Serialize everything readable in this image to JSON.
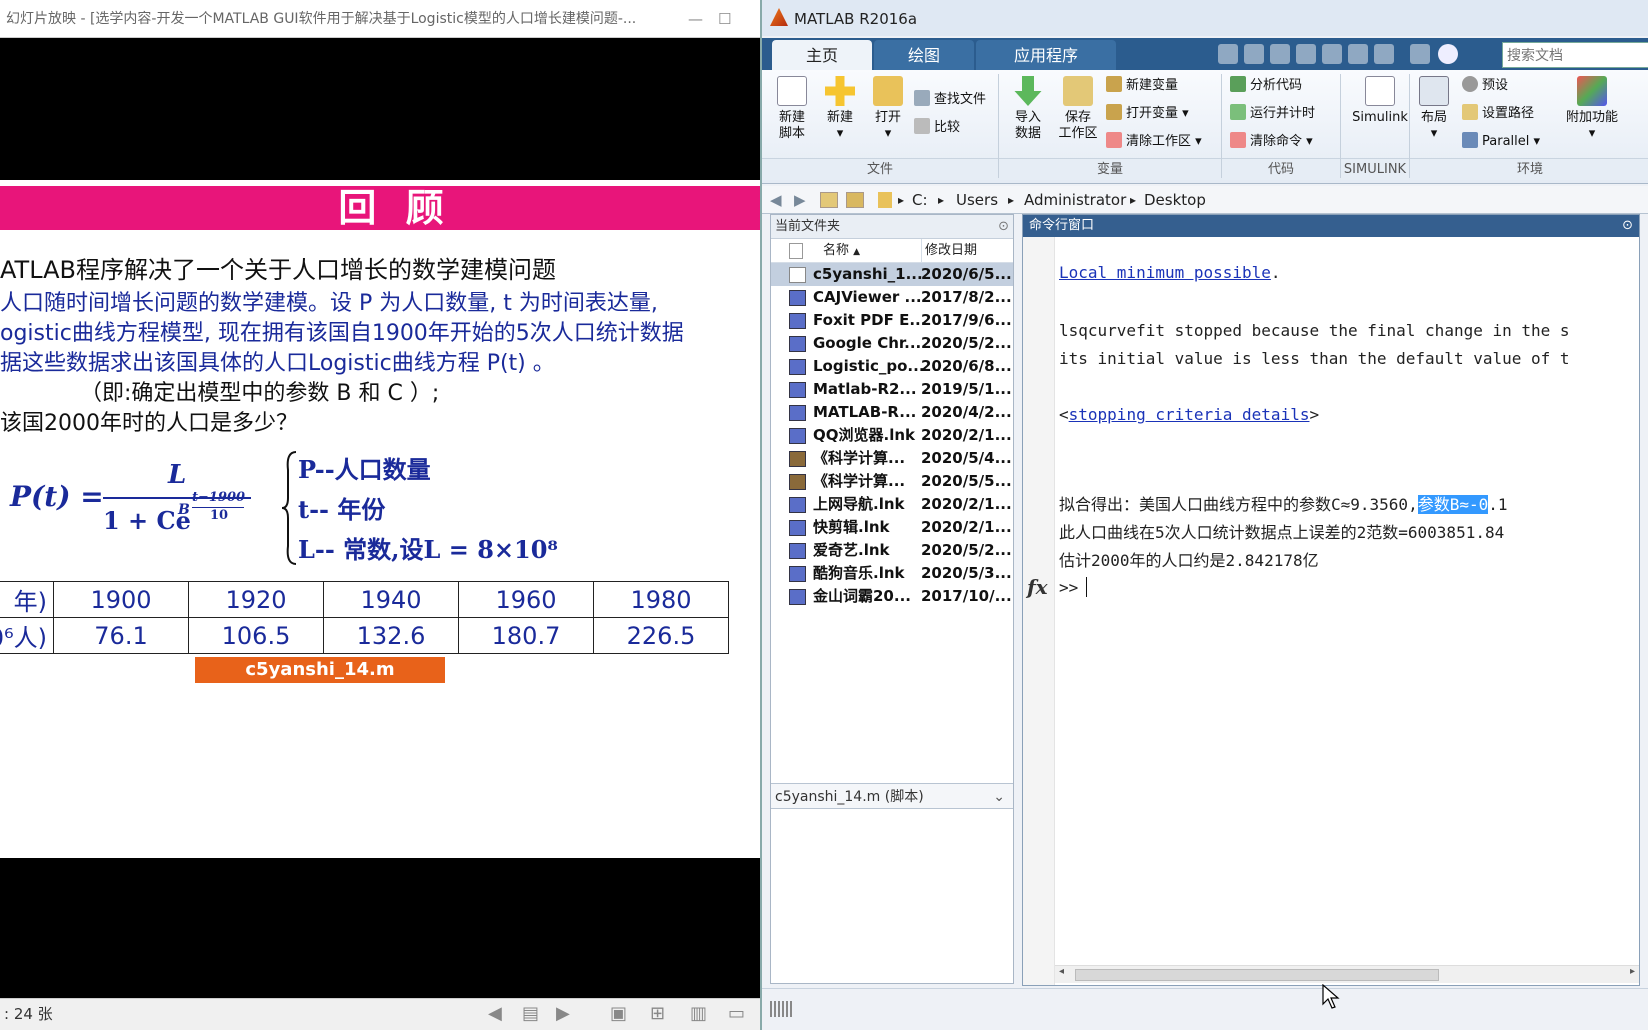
{
  "ppt": {
    "title": "幻灯片放映 - [选学内容-开发一个MATLAB GUI软件用于解决基于Logistic模型的人口增长建模问题-...",
    "minimize": "—",
    "maximize": "☐",
    "banner": "回 顾",
    "heading": "ATLAB程序解决了一个关于人口增长的数学建模问题",
    "lines": [
      "人口随时间增长问题的数学建模。设 P 为人口数量, t 为时间表达量,",
      "ogistic曲线方程模型, 现在拥有该国自1900年开始的5次人口统计数据",
      "据这些数据求出该国具体的人口Logistic曲线方程 P(t) 。",
      "（即:确定出模型中的参数 B 和 C ）;",
      "该国2000年时的人口是多少？"
    ],
    "formula": {
      "lhs": "P(t) =",
      "numerator": "L",
      "denominator": "1 + Ce",
      "base": "B",
      "exp_num": "t−1900",
      "exp_den": "10",
      "defs": [
        "P--人口数量",
        "t-- 年份",
        "L-- 常数,设L = 8×10⁸"
      ]
    },
    "table": {
      "row1_label": "年)",
      "row2_label": "0⁶人)",
      "years": [
        "1900",
        "1920",
        "1940",
        "1960",
        "1980"
      ],
      "pop": [
        "76.1",
        "106.5",
        "132.6",
        "180.7",
        "226.5"
      ]
    },
    "file_tag": "c5yanshi_14.m",
    "status": ": 24 张"
  },
  "matlab": {
    "title": "MATLAB R2016a",
    "tabs": [
      "主页",
      "绘图",
      "应用程序"
    ],
    "search_placeholder": "搜索文档",
    "ribbon": {
      "new_script": "新建\n脚本",
      "new": "新建",
      "open": "打开",
      "find_files": "查找文件",
      "compare": "比较",
      "import": "导入\n数据",
      "save_ws": "保存\n工作区",
      "new_var": "新建变量",
      "open_var": "打开变量",
      "clear_ws": "清除工作区",
      "analyze": "分析代码",
      "run_time": "运行并计时",
      "clear_cmd": "清除命令",
      "simulink": "Simulink",
      "layout": "布局",
      "prefs": "预设",
      "set_path": "设置路径",
      "parallel": "Parallel",
      "addons": "附加功能",
      "groups": [
        "文件",
        "变量",
        "代码",
        "SIMULINK",
        "环境"
      ]
    },
    "path": [
      "C:",
      "Users",
      "Administrator",
      "Desktop"
    ],
    "folder_panel": {
      "title": "当前文件夹",
      "col_name": "名称",
      "col_date": "修改日期",
      "files": [
        {
          "name": "c5yanshi_1...",
          "date": "2020/6/5..."
        },
        {
          "name": "CAJViewer ...",
          "date": "2017/8/2..."
        },
        {
          "name": "Foxit PDF E...",
          "date": "2017/9/6..."
        },
        {
          "name": "Google Chr...",
          "date": "2020/5/2..."
        },
        {
          "name": "Logistic_po...",
          "date": "2020/6/8..."
        },
        {
          "name": "Matlab-R2...",
          "date": "2019/5/1..."
        },
        {
          "name": "MATLAB-R...",
          "date": "2020/4/2..."
        },
        {
          "name": "QQ浏览器.lnk",
          "date": "2020/2/1..."
        },
        {
          "name": "《科学计算...",
          "date": "2020/5/4..."
        },
        {
          "name": "《科学计算...",
          "date": "2020/5/5..."
        },
        {
          "name": "上网导航.lnk",
          "date": "2020/2/1..."
        },
        {
          "name": "快剪辑.lnk",
          "date": "2020/2/1..."
        },
        {
          "name": "爱奇艺.lnk",
          "date": "2020/5/2..."
        },
        {
          "name": "酷狗音乐.lnk",
          "date": "2020/5/3..."
        },
        {
          "name": "金山词霸20...",
          "date": "2017/10/..."
        }
      ],
      "detail": "c5yanshi_14.m  (脚本)"
    },
    "command_window": {
      "title": "命令行窗口",
      "link1": "Local minimum possible",
      "period": ".",
      "line2": "lsqcurvefit stopped because the final change in the s",
      "line3": "its initial value is less than the default value of t",
      "lt": "<",
      "link2": "stopping criteria details",
      "gt": ">",
      "result1a": "拟合得出：美国人口曲线方程中的参数C≈9.3560,",
      "result1b": "参数B≈-0",
      "result1c": ".1",
      "result2": "此人口曲线在5次人口统计数据点上误差的2范数=6003851.84",
      "result3": "估计2000年的人口约是2.842178亿",
      "prompt": ">>",
      "fx": "fx"
    }
  },
  "colors": {
    "banner": "#e8157a",
    "tag": "#e8621a",
    "matlab_tab": "#2b5c8e",
    "selection": "#3399ff"
  }
}
